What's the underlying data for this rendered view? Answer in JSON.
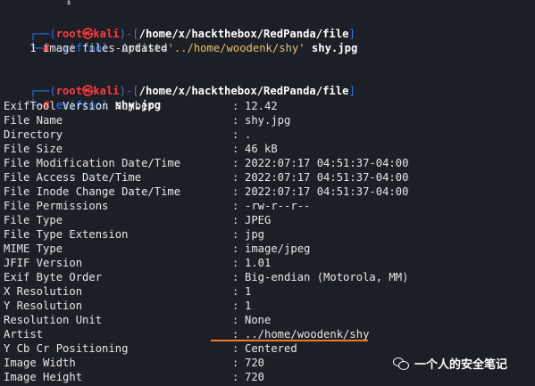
{
  "prompt1": {
    "corner": "┌──(",
    "user": "root",
    "at": "㉿",
    "host": "kali",
    "close": ")-[",
    "path": "/home/x/hackthebox/RedPanda/file",
    "end": "]",
    "arrow": "└─",
    "hash": "#",
    "cmd": "exiftool",
    "arg1": " -Artist=",
    "quoted": "'../home/woodenk/shy'",
    "file": " shy.jpg"
  },
  "output1": "    1 image files updated",
  "prompt2": {
    "corner": "┌──(",
    "user": "root",
    "at": "㉿",
    "host": "kali",
    "close": ")-[",
    "path": "/home/x/hackthebox/RedPanda/file",
    "end": "]",
    "arrow": "└─",
    "hash": "#",
    "cmd": "exiftool",
    "file": " shy.jpg"
  },
  "exif_rows": [
    {
      "key": "ExifTool Version Number",
      "value": "12.42"
    },
    {
      "key": "File Name",
      "value": "shy.jpg"
    },
    {
      "key": "Directory",
      "value": "."
    },
    {
      "key": "File Size",
      "value": "46 kB"
    },
    {
      "key": "File Modification Date/Time",
      "value": "2022:07:17 04:51:37-04:00"
    },
    {
      "key": "File Access Date/Time",
      "value": "2022:07:17 04:51:37-04:00"
    },
    {
      "key": "File Inode Change Date/Time",
      "value": "2022:07:17 04:51:37-04:00"
    },
    {
      "key": "File Permissions",
      "value": "-rw-r--r--"
    },
    {
      "key": "File Type",
      "value": "JPEG"
    },
    {
      "key": "File Type Extension",
      "value": "jpg"
    },
    {
      "key": "MIME Type",
      "value": "image/jpeg"
    },
    {
      "key": "JFIF Version",
      "value": "1.01"
    },
    {
      "key": "Exif Byte Order",
      "value": "Big-endian (Motorola, MM)"
    },
    {
      "key": "X Resolution",
      "value": "1"
    },
    {
      "key": "Y Resolution",
      "value": "1"
    },
    {
      "key": "Resolution Unit",
      "value": "None"
    },
    {
      "key": "Artist",
      "value": "../home/woodenk/shy"
    },
    {
      "key": "Y Cb Cr Positioning",
      "value": "Centered"
    },
    {
      "key": "Image Width",
      "value": "720"
    },
    {
      "key": "Image Height",
      "value": "720"
    }
  ],
  "separator": ":",
  "watermark_text": "一个人的安全笔记",
  "icons": {
    "wechat": "wechat-icon"
  },
  "colors": {
    "background": "#1c1f26",
    "prompt_blue": "#2f77e8",
    "prompt_red": "#ff3a3a",
    "highlight_orange": "#f07a2a"
  }
}
